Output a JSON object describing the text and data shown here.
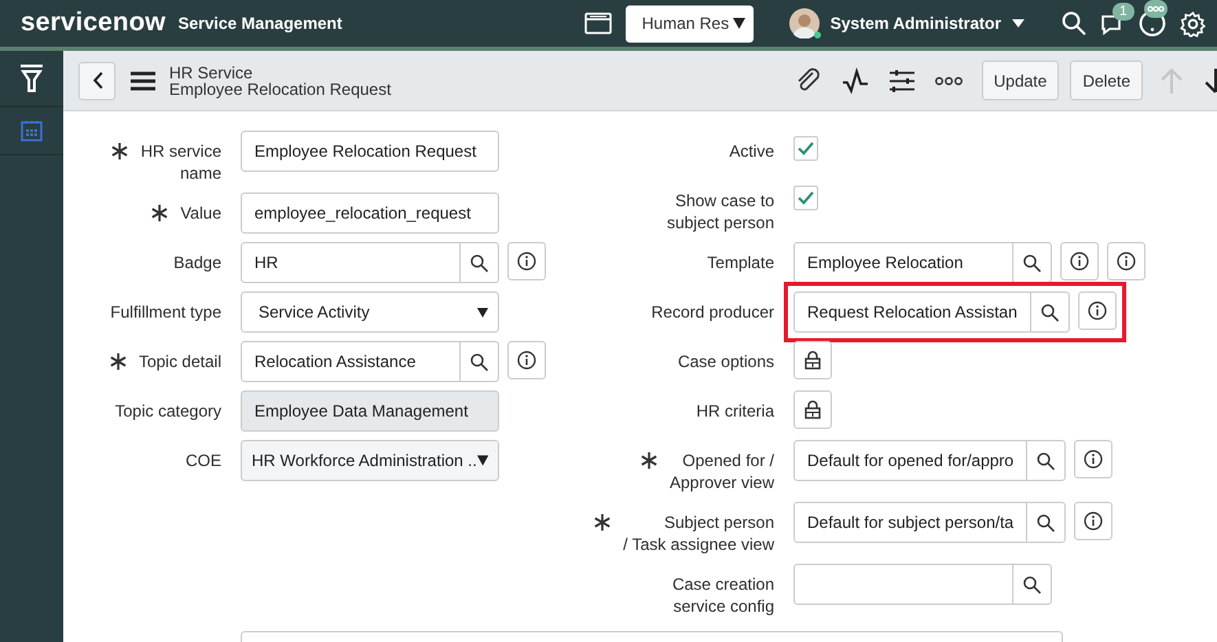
{
  "header": {
    "logo": "servicenow",
    "app_title": "Service Management",
    "scope_select": "Human Res",
    "user": {
      "name": "System Administrator",
      "online": true
    },
    "notification_count": "1"
  },
  "sidebar": {
    "tabs": [
      {
        "kind": "filter",
        "selected": false
      },
      {
        "kind": "calendar",
        "selected": true
      }
    ]
  },
  "form_header": {
    "breadcrumb": "HR Service",
    "title": "Employee Relocation Request",
    "buttons": [
      {
        "label": "Update"
      },
      {
        "label": "Delete"
      }
    ]
  },
  "left_fields": [
    {
      "kind": "text",
      "label": "HR service\nname",
      "required": true,
      "value": "Employee Relocation Request"
    },
    {
      "kind": "text",
      "label": "Value",
      "required": true,
      "value": "employee_relocation_request"
    },
    {
      "kind": "reference",
      "label": "Badge",
      "required": false,
      "value": "HR",
      "actions": [
        {
          "kind": "info"
        }
      ]
    },
    {
      "kind": "select",
      "label": "Fulfillment type",
      "required": false,
      "value": "Service Activity"
    },
    {
      "kind": "reference",
      "label": "Topic detail",
      "required": true,
      "value": "Relocation Assistance",
      "actions": [
        {
          "kind": "info"
        }
      ]
    },
    {
      "kind": "readonly",
      "label": "Topic category",
      "required": false,
      "value": "Employee Data Management"
    },
    {
      "kind": "choice",
      "label": "COE",
      "required": false,
      "value": "HR Workforce Administration .."
    }
  ],
  "right_fields": [
    {
      "kind": "checkbox",
      "label": "Active",
      "required": false,
      "checked": true
    },
    {
      "kind": "checkbox",
      "label": "Show case to\nsubject person",
      "required": false,
      "checked": true
    },
    {
      "kind": "reference",
      "label": "Template",
      "required": false,
      "value": "Employee Relocation",
      "actions": [
        {
          "kind": "info"
        },
        {
          "kind": "info"
        }
      ]
    },
    {
      "kind": "reference",
      "label": "Record producer",
      "required": false,
      "value": "Request Relocation Assistan",
      "actions": [
        {
          "kind": "info"
        }
      ],
      "highlighted": true
    },
    {
      "kind": "lock",
      "label": "Case options",
      "required": false
    },
    {
      "kind": "lock",
      "label": "HR criteria",
      "required": false
    },
    {
      "kind": "reference",
      "label": "Opened for /\nApprover view",
      "required": true,
      "value": "Default for opened for/appro",
      "actions": [
        {
          "kind": "info"
        }
      ]
    },
    {
      "kind": "reference",
      "label": "Subject person\n/ Task assignee view",
      "required": true,
      "value": "Default for subject person/ta",
      "actions": [
        {
          "kind": "info"
        }
      ]
    },
    {
      "kind": "reference",
      "label": "Case creation\nservice config",
      "required": false
    }
  ],
  "wide_field": {
    "kind": "textarea"
  }
}
